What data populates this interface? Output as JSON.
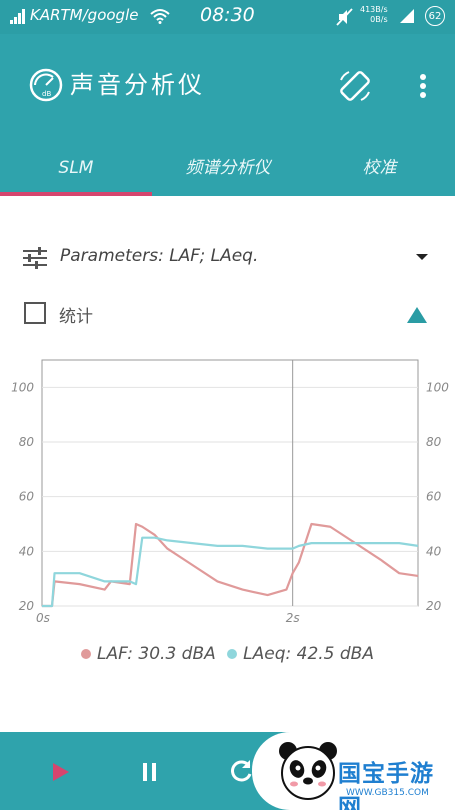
{
  "status_bar": {
    "carrier": "KARTM/google",
    "time": "08:30",
    "up_speed": "413B/s",
    "down_speed": "0B/s",
    "battery": "62"
  },
  "app": {
    "title": "声音分析仪",
    "logo_text": "dB",
    "tabs": [
      {
        "label": "SLM",
        "active": true
      },
      {
        "label": "频谱分析仪",
        "active": false
      },
      {
        "label": "校准",
        "active": false
      }
    ]
  },
  "params": {
    "label": "Parameters: LAF; LAeq."
  },
  "stats": {
    "label": "统计",
    "checked": false
  },
  "legend": {
    "laf_label": "LAF: 30.3 dBA",
    "laeq_label": "LAeq: 42.5 dBA"
  },
  "watermark": {
    "brand": "国宝手游网",
    "url": "WWW.GB315.COM"
  },
  "colors": {
    "primary": "#2fa3ac",
    "indicator": "#d6456e",
    "laf": "#e09a9a",
    "laeq": "#8fd6dc"
  },
  "chart_data": {
    "type": "line",
    "x_ticks": [
      {
        "value": 0,
        "label": "0s"
      },
      {
        "value": 2,
        "label": "2s"
      }
    ],
    "y_ticks": [
      20,
      40,
      60,
      80,
      100
    ],
    "xlim": [
      0,
      3.0
    ],
    "ylim": [
      20,
      110
    ],
    "grid": true,
    "series": [
      {
        "name": "LAF",
        "color": "#e09a9a",
        "x": [
          0,
          0.08,
          0.1,
          0.3,
          0.5,
          0.55,
          0.7,
          0.75,
          0.8,
          0.9,
          1.0,
          1.2,
          1.4,
          1.6,
          1.8,
          1.95,
          2.0,
          2.05,
          2.15,
          2.3,
          2.5,
          2.7,
          2.85,
          3.0
        ],
        "y": [
          20,
          20,
          29,
          28,
          26,
          29,
          28,
          50,
          49,
          46,
          41,
          35,
          29,
          26,
          24,
          26,
          32,
          36,
          50,
          49,
          43,
          37,
          32,
          31
        ]
      },
      {
        "name": "LAeq",
        "color": "#8fd6dc",
        "x": [
          0,
          0.08,
          0.1,
          0.3,
          0.5,
          0.7,
          0.75,
          0.8,
          0.9,
          1.0,
          1.2,
          1.4,
          1.6,
          1.8,
          1.95,
          2.0,
          2.05,
          2.15,
          2.3,
          2.5,
          2.7,
          2.85,
          3.0
        ],
        "y": [
          20,
          20,
          32,
          32,
          29,
          29,
          28,
          45,
          45,
          44,
          43,
          42,
          42,
          41,
          41,
          41,
          42,
          43,
          43,
          43,
          43,
          43,
          42
        ]
      }
    ]
  }
}
